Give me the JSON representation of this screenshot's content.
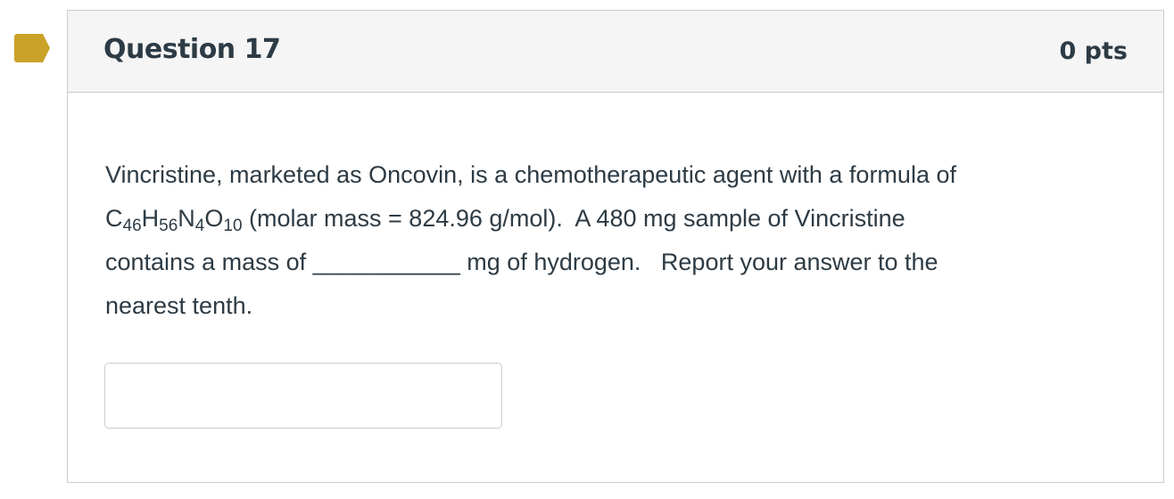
{
  "question": {
    "title": "Question 17",
    "points": "0 pts",
    "text": {
      "line1": "Vincristine, marketed as Oncovin, is a chemotherapeutic agent with a formula of",
      "formula": {
        "c": "C",
        "c_sub": "46",
        "h": "H",
        "h_sub": "56",
        "n": "N",
        "n_sub": "4",
        "o": "O",
        "o_sub": "10"
      },
      "line2_rest": " (molar mass = 824.96 g/mol).  A 480 mg sample of Vincristine",
      "line3": "contains a mass of ___________ mg of hydrogen.   Report your answer to the",
      "line4": "nearest tenth."
    },
    "answer": {
      "value": "",
      "placeholder": ""
    }
  },
  "colors": {
    "flag": "#c9a227",
    "header_bg": "#f5f5f5",
    "border": "#c7cdd1",
    "text": "#2d3b45"
  }
}
